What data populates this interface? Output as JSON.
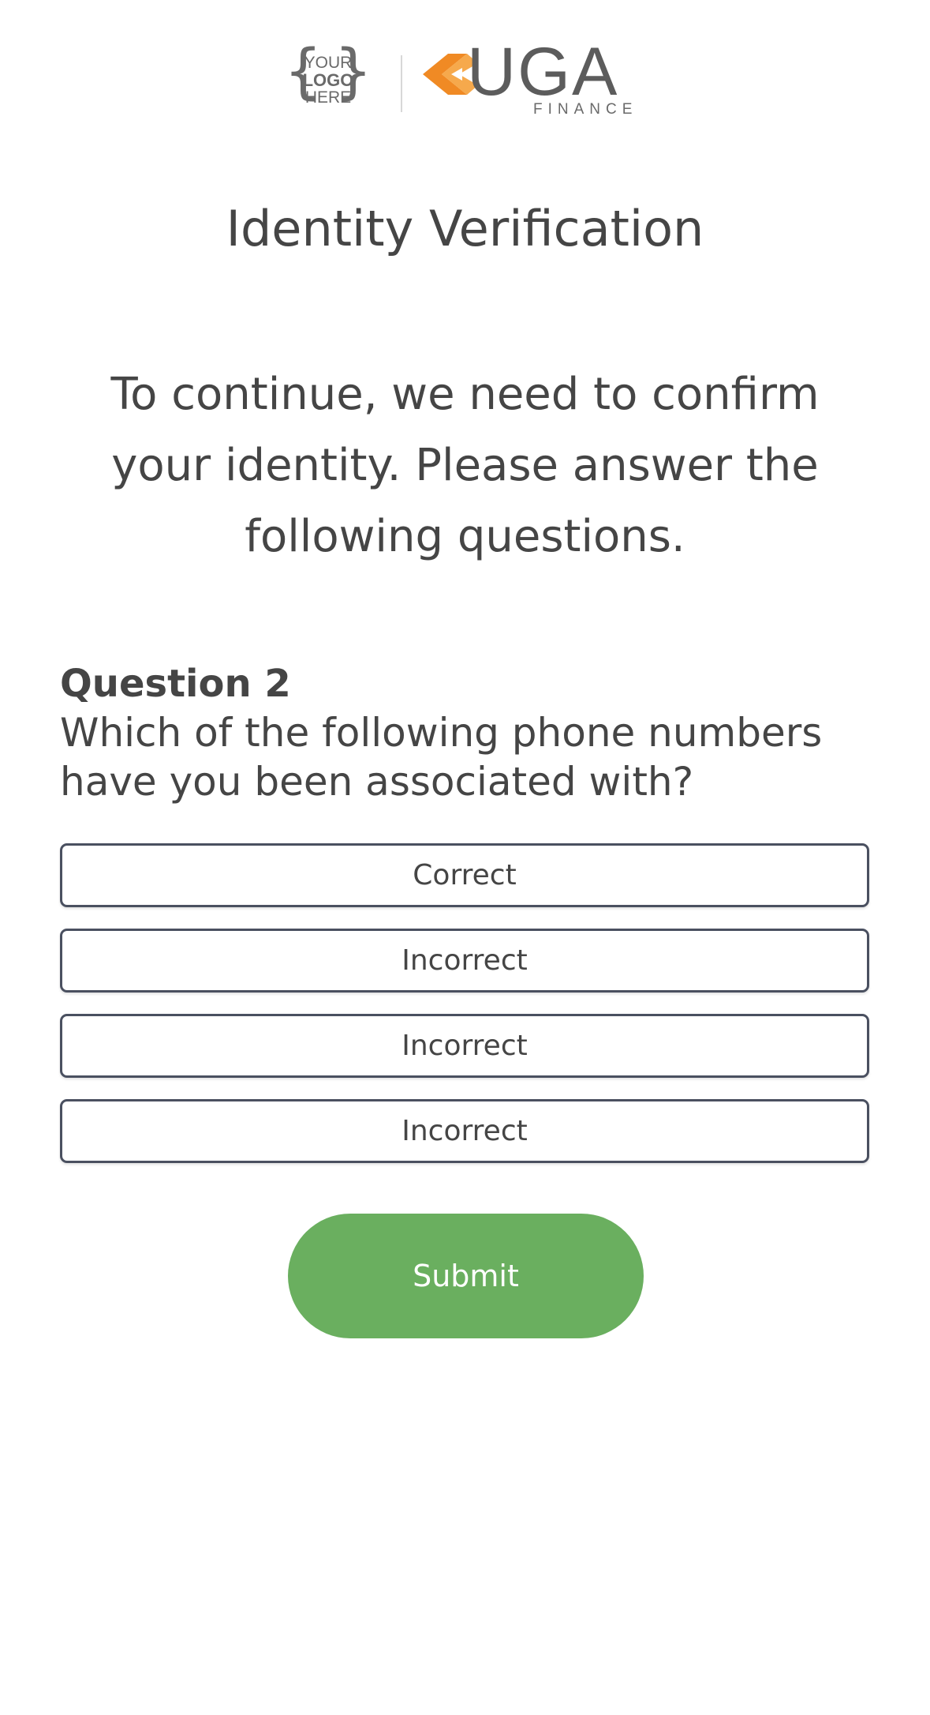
{
  "header": {
    "placeholder_logo": {
      "line1": "YOUR",
      "line2": "LOGO",
      "line3": "HERE",
      "icon": "logo-placeholder-icon"
    },
    "brand_logo": {
      "word": "UGA",
      "sub": "FINANCE",
      "icon": "uga-finance-logo-icon",
      "colors": {
        "mark": "#f08a24",
        "word": "#5c5c5c"
      }
    }
  },
  "page": {
    "title": "Identity Verification",
    "intro": "To continue, we need to confirm your identity. Please answer the following questions."
  },
  "question": {
    "label": "Question 2",
    "text": "Which of the following phone numbers have you been associated with?",
    "answers": [
      {
        "label": "Correct"
      },
      {
        "label": "Incorrect"
      },
      {
        "label": "Incorrect"
      },
      {
        "label": "Incorrect"
      }
    ]
  },
  "actions": {
    "submit_label": "Submit",
    "submit_color": "#6aaf5f"
  },
  "colors": {
    "text": "#454545",
    "answer_border": "#4a5060",
    "background": "#ffffff"
  }
}
